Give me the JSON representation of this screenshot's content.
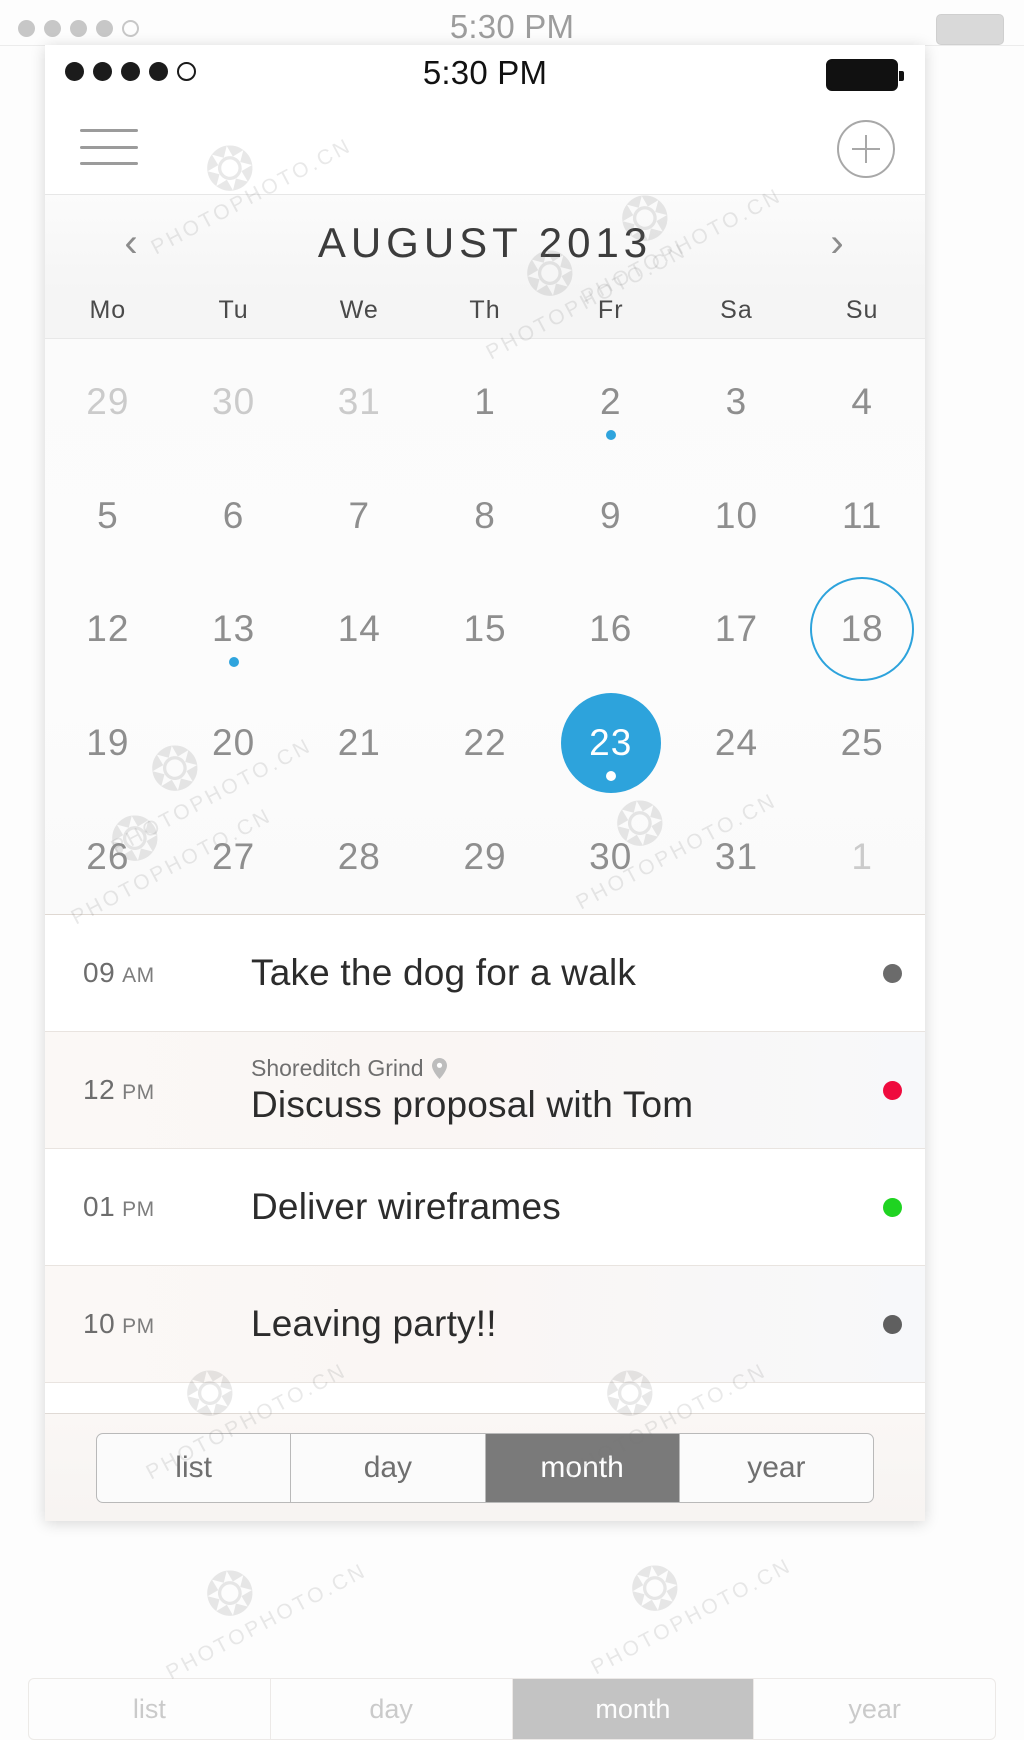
{
  "background": {
    "status_time": "5:30 PM",
    "tabs": [
      "list",
      "day",
      "month",
      "year"
    ],
    "active_tab": "month"
  },
  "statusbar": {
    "time": "5:30 PM",
    "signal_dots": [
      "filled",
      "filled",
      "filled",
      "filled",
      "hollow"
    ],
    "battery_icon": "battery-full-icon"
  },
  "navbar": {
    "menu_icon": "hamburger-menu-icon",
    "add_icon": "plus-circle-icon"
  },
  "month_header": {
    "title": "AUGUST 2013",
    "prev_icon": "chevron-left-icon",
    "next_icon": "chevron-right-icon"
  },
  "weekdays": [
    "Mo",
    "Tu",
    "We",
    "Th",
    "Fr",
    "Sa",
    "Su"
  ],
  "calendar": {
    "rows": [
      [
        {
          "day": "29",
          "muted": true
        },
        {
          "day": "30",
          "muted": true
        },
        {
          "day": "31",
          "muted": true
        },
        {
          "day": "1"
        },
        {
          "day": "2",
          "dot": true
        },
        {
          "day": "3"
        },
        {
          "day": "4"
        }
      ],
      [
        {
          "day": "5"
        },
        {
          "day": "6"
        },
        {
          "day": "7"
        },
        {
          "day": "8"
        },
        {
          "day": "9"
        },
        {
          "day": "10"
        },
        {
          "day": "11"
        }
      ],
      [
        {
          "day": "12"
        },
        {
          "day": "13",
          "dot": true
        },
        {
          "day": "14"
        },
        {
          "day": "15"
        },
        {
          "day": "16"
        },
        {
          "day": "17"
        },
        {
          "day": "18",
          "today": true
        }
      ],
      [
        {
          "day": "19"
        },
        {
          "day": "20"
        },
        {
          "day": "21"
        },
        {
          "day": "22"
        },
        {
          "day": "23",
          "selected": true,
          "dot": true
        },
        {
          "day": "24"
        },
        {
          "day": "25"
        }
      ],
      [
        {
          "day": "26"
        },
        {
          "day": "27"
        },
        {
          "day": "28"
        },
        {
          "day": "29"
        },
        {
          "day": "30"
        },
        {
          "day": "31"
        },
        {
          "day": "1",
          "muted": true
        }
      ]
    ]
  },
  "agenda": {
    "events": [
      {
        "time": "09",
        "meridiem": "AM",
        "location": "",
        "title": "Take the dog for a walk",
        "dot_color": "#6b6b6b",
        "tinted": false
      },
      {
        "time": "12",
        "meridiem": "PM",
        "location": "Shoreditch Grind",
        "location_icon": "map-pin-icon",
        "title": "Discuss proposal with Tom",
        "dot_color": "#ef0b3e",
        "tinted": true
      },
      {
        "time": "01",
        "meridiem": "PM",
        "location": "",
        "title": "Deliver wireframes",
        "dot_color": "#1fd321",
        "tinted": false
      },
      {
        "time": "10",
        "meridiem": "PM",
        "location": "",
        "title": "Leaving party!!",
        "dot_color": "#5f5f5f",
        "tinted": true
      }
    ]
  },
  "tabbar": {
    "items": [
      {
        "label": "list",
        "active": false
      },
      {
        "label": "day",
        "active": false
      },
      {
        "label": "month",
        "active": true
      },
      {
        "label": "year",
        "active": false
      }
    ]
  },
  "theme": {
    "accent_blue": "#2da3dc",
    "selected_tab_bg": "#7a7a7a",
    "muted_day": "#cbcbcb",
    "day_text": "#8e8e8e"
  },
  "watermarks": {
    "text": "PHOTOPHOTO.CN"
  }
}
